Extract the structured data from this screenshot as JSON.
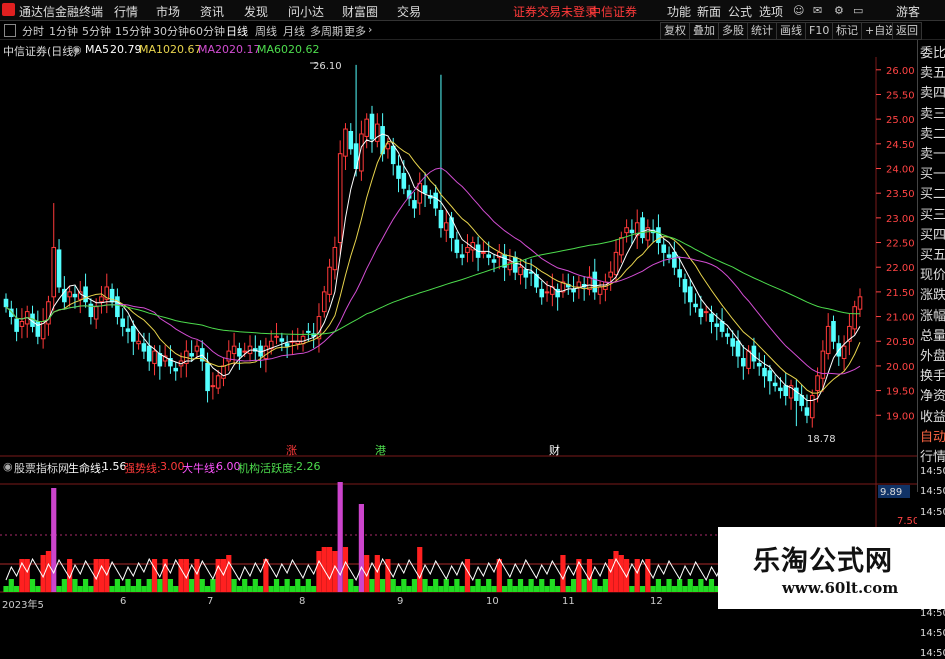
{
  "menubar": {
    "app_title": "通达信金融终端",
    "menus": [
      "行情",
      "市场",
      "资讯",
      "发现",
      "问小达",
      "财富圈",
      "交易"
    ],
    "login_status": "证券交易未登录",
    "broker": "中信证券",
    "right_items": [
      "功能",
      "新面",
      "公式",
      "选项",
      "游客"
    ],
    "colors": {
      "login_status": "#ff3a3a",
      "broker": "#ff3a3a"
    }
  },
  "toolbar": {
    "periods": [
      "分时",
      "1分钟",
      "5分钟",
      "15分钟",
      "30分钟",
      "60分钟",
      "日线",
      "周线",
      "月线",
      "多周期",
      "更多"
    ],
    "active_period": "日线",
    "right_buttons": [
      "复权",
      "叠加",
      "多股",
      "统计",
      "画线",
      "F10",
      "标记",
      "+自选",
      "返回"
    ]
  },
  "main_chart": {
    "stock_title": "中信证券(日线)",
    "ma": [
      {
        "label": "MA5",
        "value": "20.79",
        "color": "#ffffff"
      },
      {
        "label": "MA10",
        "value": "20.67",
        "color": "#e8d44d"
      },
      {
        "label": "MA20",
        "value": "20.17",
        "color": "#d24dd2"
      },
      {
        "label": "MA60",
        "value": "20.62",
        "color": "#4ddc4d"
      }
    ],
    "high_label": "26.10",
    "low_label": "18.78",
    "markers": [
      {
        "text": "涨",
        "color": "#ff3a3a"
      },
      {
        "text": "港",
        "color": "#4ddc4d"
      },
      {
        "text": "财",
        "color": "#ffffff"
      }
    ],
    "price_axis": [
      "26.00",
      "25.50",
      "25.00",
      "24.50",
      "24.00",
      "23.50",
      "23.00",
      "22.50",
      "22.00",
      "21.50",
      "21.00",
      "20.50",
      "20.00",
      "19.50",
      "19.00"
    ]
  },
  "indicator": {
    "name": "股票指标网",
    "items": [
      {
        "label": "生命线:",
        "value": "1.56",
        "color": "#ffffff"
      },
      {
        "label": "强势线:",
        "value": "3.00",
        "color": "#ff3a3a"
      },
      {
        "label": "大牛线:",
        "value": "6.00",
        "color": "#ff55ff"
      },
      {
        "label": "机构活跃度:",
        "value": "2.26",
        "color": "#4ddc4d"
      }
    ],
    "axis_values": [
      "9.89",
      "7.50"
    ]
  },
  "date_axis": [
    "2023年5",
    "6",
    "7",
    "8",
    "9",
    "10",
    "11",
    "12"
  ],
  "side_panel": [
    "委比",
    "卖五",
    "卖四",
    "卖三",
    "卖二",
    "卖一",
    "买一",
    "买二",
    "买三",
    "买四",
    "买五",
    "现价",
    "涨跌",
    "涨幅",
    "总量",
    "外盘",
    "换手",
    "净资",
    "收益",
    "自动",
    "行情",
    "14:50",
    "14:50",
    "14:50",
    "14:50",
    "14:50",
    "14:50",
    "14:50",
    "14:50",
    "14:50",
    "14:50"
  ],
  "watermark": {
    "title": "乐淘公式网",
    "url": "www.60lt.com"
  },
  "chart_data": {
    "type": "candlestick",
    "title": "中信证券(日线)",
    "ylim": [
      18.6,
      26.3
    ],
    "high": 26.1,
    "low": 18.78,
    "close_series": [
      21.2,
      21.0,
      20.7,
      20.9,
      21.1,
      20.8,
      20.6,
      20.9,
      21.3,
      22.4,
      21.6,
      21.3,
      21.5,
      21.4,
      21.5,
      21.3,
      21.0,
      21.2,
      21.4,
      21.6,
      21.3,
      21.0,
      20.8,
      20.7,
      20.5,
      20.5,
      20.3,
      20.1,
      20.3,
      20.0,
      20.2,
      20.0,
      19.9,
      20.1,
      20.3,
      20.2,
      20.4,
      20.1,
      19.5,
      19.6,
      19.8,
      20.0,
      20.3,
      20.4,
      20.2,
      20.3,
      20.4,
      20.3,
      20.2,
      20.4,
      20.5,
      20.6,
      20.5,
      20.4,
      20.5,
      20.5,
      20.6,
      20.7,
      20.6,
      21.0,
      21.5,
      22.0,
      22.4,
      24.3,
      24.8,
      24.4,
      24.0,
      24.7,
      25.0,
      24.6,
      24.9,
      24.3,
      24.5,
      24.1,
      23.8,
      23.6,
      23.4,
      23.2,
      23.7,
      23.5,
      23.4,
      23.2,
      22.8,
      22.9,
      22.6,
      22.3,
      22.2,
      22.4,
      22.5,
      22.2,
      22.3,
      22.2,
      22.1,
      22.3,
      22.0,
      22.1,
      21.9,
      22.0,
      21.8,
      21.9,
      21.6,
      21.4,
      21.5,
      21.6,
      21.4,
      21.7,
      21.6,
      21.5,
      21.7,
      21.6,
      21.8,
      21.5,
      21.6,
      21.7,
      21.9,
      22.3,
      22.6,
      22.8,
      22.7,
      22.9,
      22.6,
      22.8,
      22.7,
      22.5,
      22.3,
      22.2,
      22.0,
      21.8,
      21.5,
      21.3,
      21.2,
      21.0,
      21.1,
      20.9,
      20.8,
      20.7,
      20.6,
      20.4,
      20.2,
      20.0,
      20.3,
      20.1,
      20.0,
      19.8,
      19.7,
      19.6,
      19.5,
      19.4,
      19.6,
      19.3,
      19.2,
      19.0,
      19.4,
      19.8,
      20.3,
      20.8,
      20.5,
      20.2,
      20.4,
      20.8,
      21.2,
      21.4
    ]
  }
}
